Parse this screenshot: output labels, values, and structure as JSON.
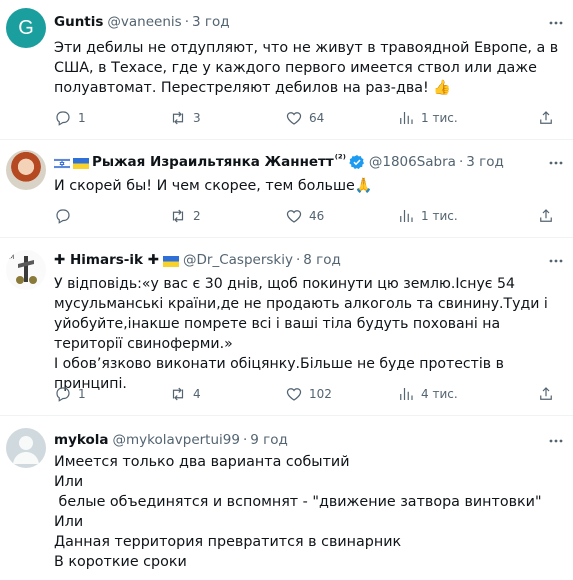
{
  "posts": [
    {
      "name": "Guntis",
      "handle": "@vaneenis",
      "time": "3 год",
      "avatar_letter": "G",
      "text": "Эти дебилы не отдупляют, что не живут в травоядной Европе, а в США, в Техасе, где у каждого первого имеется ствол или даже полуавтомат. Перестреляют дебилов на раз-два! 👍",
      "replies": "1",
      "retweets": "3",
      "likes": "64",
      "views": "1 тис."
    },
    {
      "name": "Рыжая Израильтянка Жаннетт",
      "name_suffix": "⁽²⁾",
      "handle": "@1806Sabra",
      "time": "3 год",
      "text": "И скорей бы! И чем скорее, тем больше🙏",
      "replies": "",
      "retweets": "2",
      "likes": "46",
      "views": "1 тис."
    },
    {
      "name": "✚ Himars-ik ✚",
      "handle": "@Dr_Casperskiy",
      "time": "8 год",
      "text": "У відповідь:«у вас є 30 днів, щоб покинути цю землю.Існує 54 мусульманські країни,де не продають алкоголь та свинину.Туди і уйобуйте,інакше помрете всі і ваші тіла будуть поховані на території свиноферми.»\nІ обов’язково виконати обіцянку.Більше не буде протестів в принципі.",
      "replies": "1",
      "retweets": "4",
      "likes": "102",
      "views": "4 тис."
    },
    {
      "name": "mykola",
      "handle": "@mykolavpertui99",
      "time": "9 год",
      "text": "Имеется только два варианта событий\nИли\n белые объединятся и вспомнят - \"движение затвора винтовки\"\nИли\nДанная территория превратится в свинарник\nВ короткие сроки"
    }
  ],
  "colors": {
    "guntis_avatar": "#1a9e9e",
    "verified": "#1d9bf0",
    "muted": "#536471"
  },
  "icons": [
    "reply-icon",
    "retweet-icon",
    "like-icon",
    "views-icon",
    "share-icon",
    "more-icon",
    "verified-icon"
  ]
}
